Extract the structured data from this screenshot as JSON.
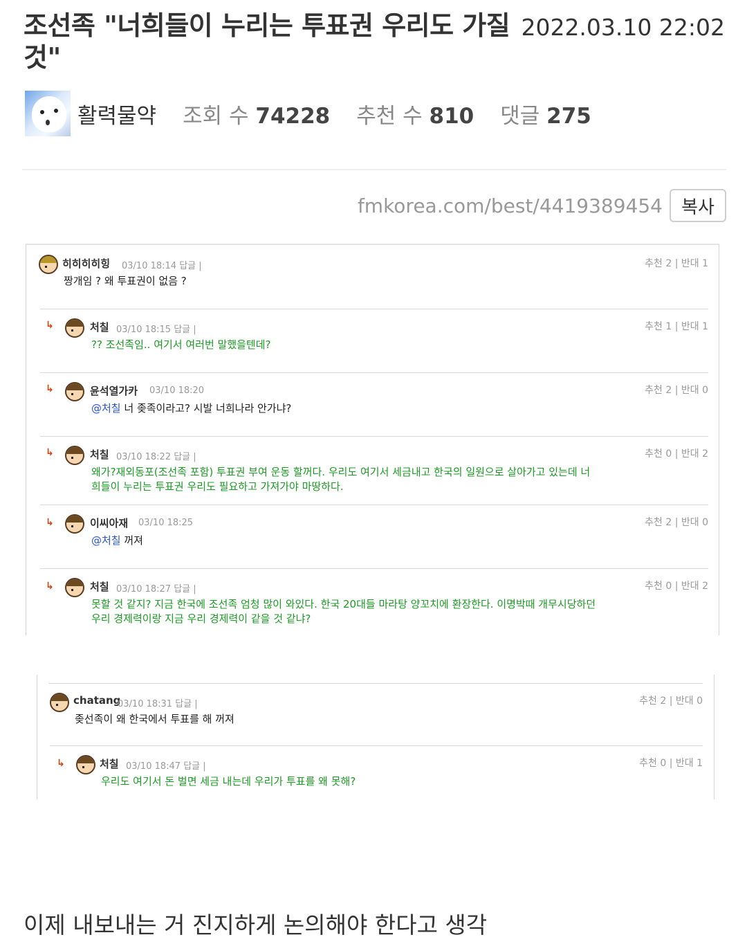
{
  "post": {
    "title": "조선족 \"너희들이 누리는 투표권 우리도 가질 것\"",
    "date": "2022.03.10 22:02",
    "author": "활력물약",
    "views_label": "조회 수",
    "views": "74228",
    "likes_label": "추천 수",
    "likes": "810",
    "comments_label": "댓글",
    "comments": "275",
    "url": "fmkorea.com/best/4419389454",
    "copy_label": "복사",
    "footer": "이제 내보내는 거 진지하게 논의해야 한다고 생각"
  },
  "shot1": {
    "comments": [
      {
        "nick": "히히히히힝",
        "time": "03/10 18:14  답글 |",
        "vote": "추천 2 | 반대 1",
        "body1": "짱개임 ? 왜 투표권이 없음 ?",
        "body2": ""
      },
      {
        "nick": "처칠",
        "time": "03/10 18:15  답글 |",
        "vote": "추천 1 | 반대 1",
        "body1": "?? 조선족임.. 여기서 여러번 말했을텐데?",
        "body2": ""
      },
      {
        "nick": "윤석열가카",
        "time": "03/10 18:20",
        "vote": "추천 2 | 반대 0",
        "mention": "@처칠",
        "body1": " 너 좆족이라고? 시발 너희나라 안가냐?",
        "body2": ""
      },
      {
        "nick": "처칠",
        "time": "03/10 18:22  답글 |",
        "vote": "추천 0 | 반대 2",
        "body1": "왜가?재외동포(조선족 포함) 투표권 부여 운동 할꺼다. 우리도 여기서 세금내고 한국의 일원으로 살아가고 있는데 너",
        "body2": "희들이 누리는 투표권 우리도 필요하고 가져가야 마땅하다."
      },
      {
        "nick": "이씨아재",
        "time": "03/10 18:25",
        "vote": "추천 2 | 반대 0",
        "mention": "@처칠",
        "body1": " 꺼져",
        "body2": ""
      },
      {
        "nick": "처칠",
        "time": "03/10 18:27  답글 |",
        "vote": "추천 0 | 반대 2",
        "body1": "못할 것 같지? 지금 한국에 조선족 엄청 많이 와있다. 한국 20대들 마라탕 양꼬치에 환장한다. 이명박때 개무시당하던",
        "body2": "우리 경제력이랑 지금 우리 경제력이 같을 것 같냐?"
      }
    ]
  },
  "shot2": {
    "comments": [
      {
        "nick": "chatang",
        "time": "03/10 18:31  답글 |",
        "vote": "추천 2 | 반대 0",
        "body1": "좆선족이 왜 한국에서 투표를 해 꺼져"
      },
      {
        "nick": "처칠",
        "time": "03/10 18:47  답글 |",
        "vote": "추천 0 | 반대 1",
        "body1": "우리도 여기서 돈 벌면 세금 내는데 우리가 투표를 왜 못해?"
      }
    ]
  },
  "icons": {
    "reply_arrow": "↳"
  }
}
